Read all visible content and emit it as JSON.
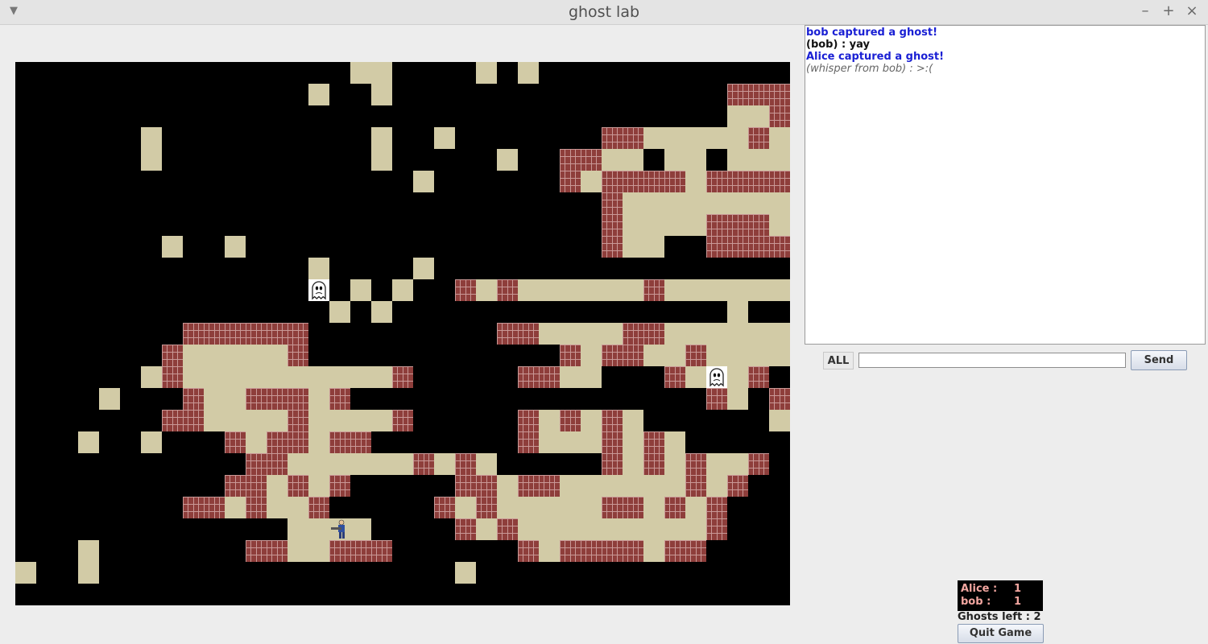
{
  "window": {
    "title": "ghost lab",
    "minimize": "–",
    "maximize": "+",
    "close": "×",
    "menu": "▼"
  },
  "chat": {
    "messages": [
      {
        "text": "bob captured a ghost!",
        "kind": "system"
      },
      {
        "text": "(bob) : yay",
        "kind": "chat"
      },
      {
        "text": "Alice captured a ghost!",
        "kind": "system"
      },
      {
        "text": "(whisper from bob) : >:(",
        "kind": "whisper"
      }
    ],
    "recipient_label": "ALL",
    "input_value": "",
    "send_label": "Send"
  },
  "scoreboard": {
    "players": [
      {
        "name": "Alice :",
        "score": "1"
      },
      {
        "name": "bob :",
        "score": "1"
      }
    ],
    "ghosts_left": "Ghosts left : 2"
  },
  "quit_label": "Quit Game",
  "colors": {
    "floor": "#d2cba6",
    "wall": "#8e3e3b",
    "background": "#000000"
  },
  "icons": {
    "ghost": "ghost-icon",
    "player": "player-character-icon"
  },
  "board": {
    "rows": [
      "                ..    . .                   ",
      "              .  .                #####.##  ",
      "                                  ..#.##...#.",
      "      .          .  .       ##.....#.##.... ",
      "      .          .     .  ##.. .. ...#......",
      "                   .      #.####.####....#.",
      "                            #............## .",
      "                            #....###.##.##...",
      "       .  .                 #..  ####. ####..",
      "              .    .                 ... ....",
      "              G . .  #.#......#.......#.#  .",
      "               . .                .     ##",
      "        ######         ##....##............",
      "       #.....#            #.##..#....#      ",
      "      .#..........#     ##..   #.G.#       ",
      "    .   #..###.#                 #. #       ",
      "       ##....#....#     #.#.#.      .       ",
      "   .  .   #.##.##       #...#.#.     #         ",
      "           ##......#.#.     #.#.#..#       ",
      "          ##.#.#     ##.##......#.#          ",
      "        ##.#..#     #.#.....##.#.#            ",
      "             ..P.    #.#.........#               ",
      "   .       ##..###      #.####.##            ",
      ".  .                 .                        ",
      "                                              ",
      "    .    .       .  .                        .",
      ".              .                              ",
      "            .   .                 .          ."
    ]
  }
}
